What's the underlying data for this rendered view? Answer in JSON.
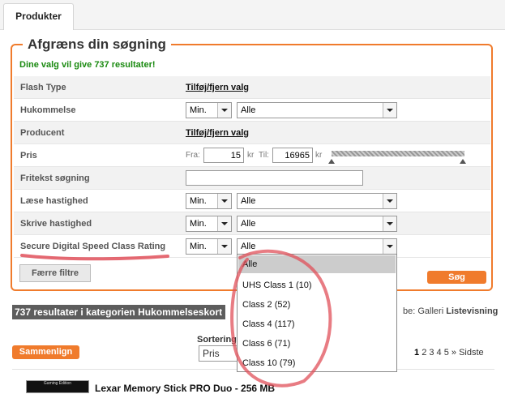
{
  "tab": {
    "label": "Produkter"
  },
  "filter": {
    "legend": "Afgræns din søgning",
    "result_text": "Dine valg vil give 737 resultater!",
    "rows": [
      {
        "label": "Flash Type",
        "link": "Tilføj/fjern valg"
      },
      {
        "label": "Hukommelse",
        "min": "Min.",
        "value": "Alle"
      },
      {
        "label": "Producent",
        "link": "Tilføj/fjern valg"
      },
      {
        "label": "Pris",
        "from_label": "Fra:",
        "from_value": "15",
        "unit": "kr",
        "to_label": "Til:",
        "to_value": "16965"
      },
      {
        "label": "Fritekst søgning",
        "value": ""
      },
      {
        "label": "Læse hastighed",
        "min": "Min.",
        "value": "Alle"
      },
      {
        "label": "Skrive hastighed",
        "min": "Min.",
        "value": "Alle"
      },
      {
        "label": "Secure Digital Speed Class Rating",
        "min": "Min.",
        "value": "Alle"
      }
    ],
    "fewer_filters": "Færre filtre",
    "search": "Søg"
  },
  "dropdown": {
    "options": [
      "Alle",
      "UHS Class 1 (10)",
      "Class 2 (52)",
      "Class 4 (117)",
      "Class 6 (71)",
      "Class 10 (79)"
    ],
    "selected": "Alle"
  },
  "results": {
    "header": "737 resultater i kategorien Hukommelseskort",
    "view_prefix": "be:",
    "view_gallery": "Galleri",
    "view_list": "Listevisning",
    "compare": "Sammenlign",
    "sort_label": "Sortering",
    "sort_value": "Pris",
    "pages_current": "1",
    "pages_rest": "2 3 4 5",
    "pages_next": "»",
    "pages_last": "Sidste",
    "product_title": "Lexar Memory Stick PRO Duo - 256 MB",
    "thumb_text": "Gaming Edition"
  },
  "colors": {
    "accent": "#f07b2c",
    "annotation": "#e0505a",
    "success": "#1a8a10"
  }
}
